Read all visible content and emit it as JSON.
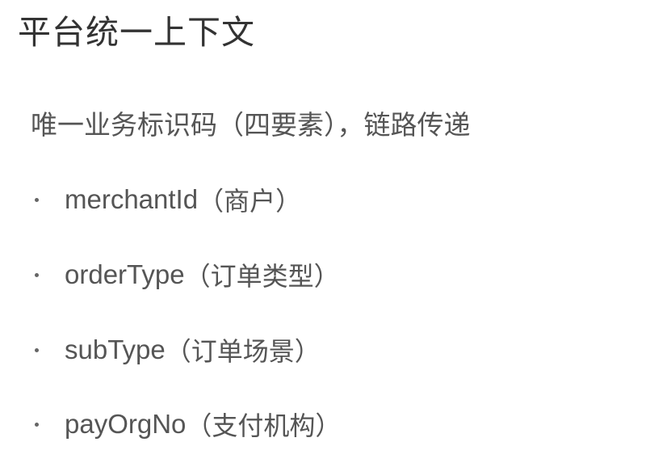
{
  "title": "平台统一上下文",
  "subtitle": "唯一业务标识码（四要素），链路传递",
  "items": [
    {
      "key": "merchantId",
      "desc": "（商户）"
    },
    {
      "key": "orderType",
      "desc": "（订单类型）"
    },
    {
      "key": "subType",
      "desc": "（订单场景）"
    },
    {
      "key": "payOrgNo",
      "desc": "（支付机构）"
    }
  ]
}
